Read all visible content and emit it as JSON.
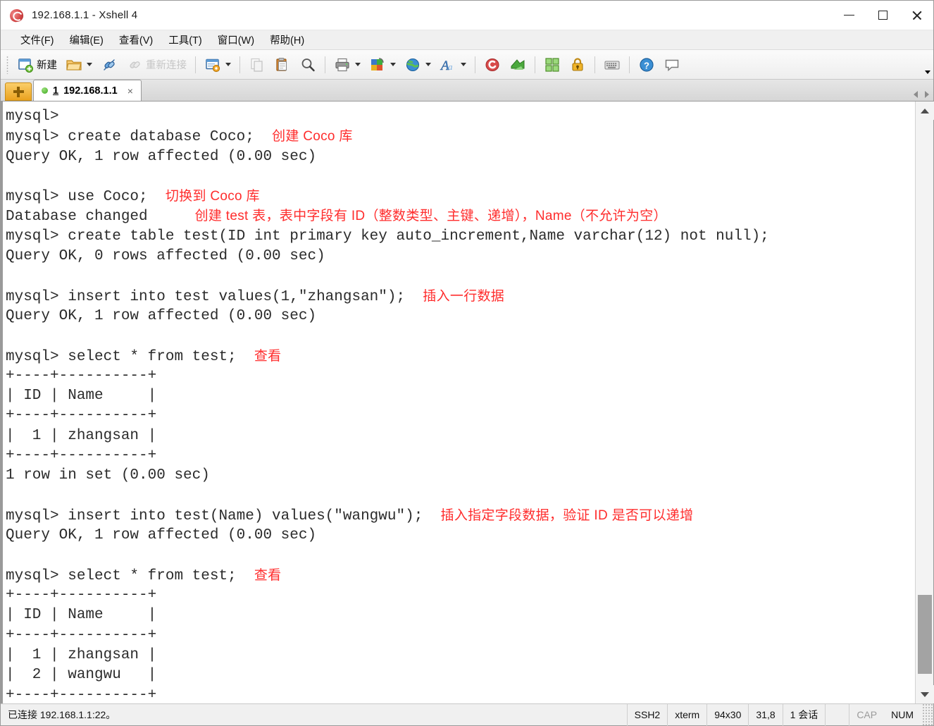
{
  "window": {
    "title": "192.168.1.1 - Xshell 4",
    "app_icon": "xshell-logo-icon",
    "minimize_label": "",
    "maximize_label": "",
    "close_label": ""
  },
  "menu": {
    "items": [
      {
        "label": "文件(F)",
        "name": "menu-file"
      },
      {
        "label": "编辑(E)",
        "name": "menu-edit"
      },
      {
        "label": "查看(V)",
        "name": "menu-view"
      },
      {
        "label": "工具(T)",
        "name": "menu-tools"
      },
      {
        "label": "窗口(W)",
        "name": "menu-window"
      },
      {
        "label": "帮助(H)",
        "name": "menu-help"
      }
    ]
  },
  "toolbar": {
    "new_label": "新建",
    "reconnect_label": "重新连接",
    "icons": [
      "new-session-icon",
      "open-folder-icon",
      "connect-icon",
      "reconnect-icon",
      "session-manager-icon",
      "copy-icon",
      "paste-icon",
      "find-icon",
      "print-icon",
      "color-scheme-icon",
      "web-icon",
      "font-icon",
      "xshell-icon",
      "xftp-icon",
      "tile-icon",
      "lock-icon",
      "keyboard-icon",
      "help-icon",
      "comment-icon"
    ],
    "overflow_label": ""
  },
  "tabbar": {
    "add_tab_label": "",
    "tabs": [
      {
        "number": "1",
        "title": "192.168.1.1",
        "status": "connected",
        "close_label": "×"
      }
    ],
    "nav_prev_label": "",
    "nav_next_label": ""
  },
  "terminal": {
    "lines": [
      [
        {
          "t": "mysql>"
        }
      ],
      [
        {
          "t": "mysql> create database Coco;  "
        },
        {
          "t": "创建 Coco 库",
          "c": 1
        }
      ],
      [
        {
          "t": "Query OK, 1 row affected (0.00 sec)"
        }
      ],
      [
        {
          "t": ""
        }
      ],
      [
        {
          "t": "mysql> use Coco;  "
        },
        {
          "t": "切换到 Coco 库",
          "c": 1
        }
      ],
      [
        {
          "t": "Database changed"
        },
        {
          "t": "            创建 test 表，表中字段有 ID（整数类型、主键、递增），Name（不允许为空）",
          "c": 1
        }
      ],
      [
        {
          "t": "mysql> create table test(ID int primary key auto_increment,Name varchar(12) not null);"
        }
      ],
      [
        {
          "t": "Query OK, 0 rows affected (0.00 sec)"
        }
      ],
      [
        {
          "t": ""
        }
      ],
      [
        {
          "t": "mysql> insert into test values(1,\"zhangsan\");  "
        },
        {
          "t": "插入一行数据",
          "c": 1
        }
      ],
      [
        {
          "t": "Query OK, 1 row affected (0.00 sec)"
        }
      ],
      [
        {
          "t": ""
        }
      ],
      [
        {
          "t": "mysql> select * from test;  "
        },
        {
          "t": "查看",
          "c": 1
        }
      ],
      [
        {
          "t": "+----+----------+"
        }
      ],
      [
        {
          "t": "| ID | Name     |"
        }
      ],
      [
        {
          "t": "+----+----------+"
        }
      ],
      [
        {
          "t": "|  1 | zhangsan |"
        }
      ],
      [
        {
          "t": "+----+----------+"
        }
      ],
      [
        {
          "t": "1 row in set (0.00 sec)"
        }
      ],
      [
        {
          "t": ""
        }
      ],
      [
        {
          "t": "mysql> insert into test(Name) values(\"wangwu\");  "
        },
        {
          "t": "插入指定字段数据，验证 ID 是否可以递增",
          "c": 1
        }
      ],
      [
        {
          "t": "Query OK, 1 row affected (0.00 sec)"
        }
      ],
      [
        {
          "t": ""
        }
      ],
      [
        {
          "t": "mysql> select * from test;  "
        },
        {
          "t": "查看",
          "c": 1
        }
      ],
      [
        {
          "t": "+----+----------+"
        }
      ],
      [
        {
          "t": "| ID | Name     |"
        }
      ],
      [
        {
          "t": "+----+----------+"
        }
      ],
      [
        {
          "t": "|  1 | zhangsan |"
        }
      ],
      [
        {
          "t": "|  2 | wangwu   |"
        }
      ],
      [
        {
          "t": "+----+----------+"
        }
      ]
    ]
  },
  "scrollbar": {
    "up_label": "",
    "down_label": "",
    "thumb_top_pct": 84,
    "thumb_height_pct": 14
  },
  "statusbar": {
    "connection": "已连接 192.168.1.1:22。",
    "protocol": "SSH2",
    "terminal_type": "xterm",
    "size": "94x30",
    "cursor": "31,8",
    "sessions": "1 会话",
    "caps": "CAP",
    "num": "NUM"
  },
  "colors": {
    "annotation_red": "#ff2d2d",
    "terminal_fg": "#2b2b2b",
    "terminal_bg": "#ffffff",
    "accent_orange": "#e9a21f",
    "status_dot_green": "#3da81f"
  }
}
